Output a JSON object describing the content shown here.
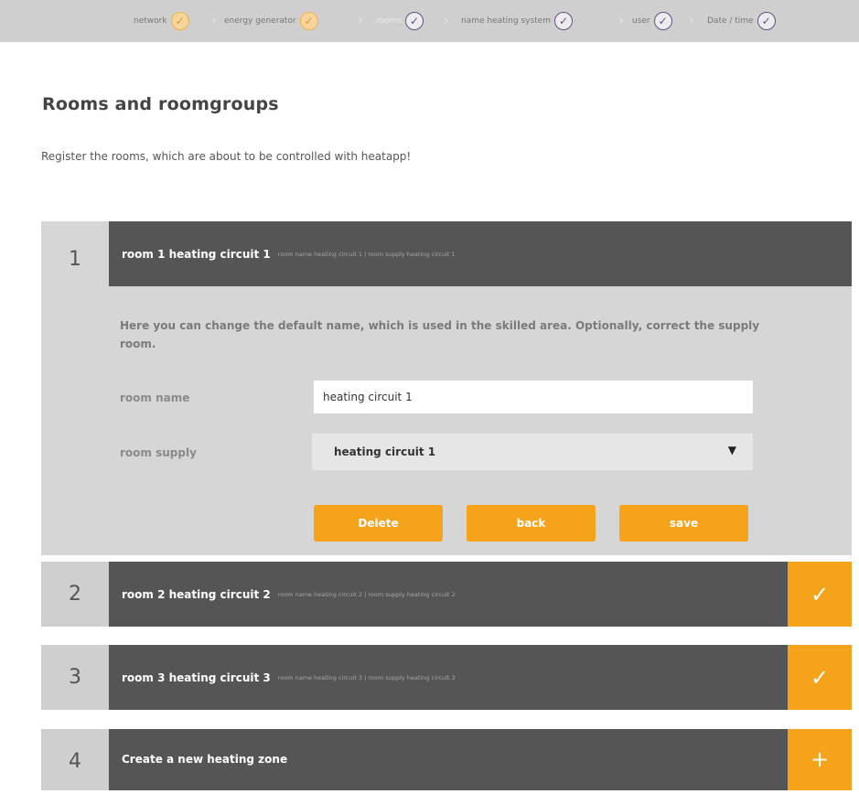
{
  "steps": [
    {
      "label": "network",
      "state": "done-orange"
    },
    {
      "label": "energy generator",
      "state": "done-orange"
    },
    {
      "label": "rooms",
      "state": "current"
    },
    {
      "label": "name heating system",
      "state": "done-purple"
    },
    {
      "label": "user",
      "state": "done-purple"
    },
    {
      "label": "Date / time",
      "state": "done-purple"
    }
  ],
  "step_icon": "✓",
  "step_separator": "›",
  "page": {
    "title": "Rooms and roomgroups",
    "intro": "Register the rooms, which are about to be controlled with heatapp!"
  },
  "rooms": [
    {
      "number": "1",
      "title": "room 1 heating circuit 1",
      "subtitle": "room name heating circuit 1 | room supply heating circuit 1",
      "help": "Here you can change the default name, which is used in the skilled area. Optionally, correct the supply room.",
      "room_name_label": "room name",
      "room_name_value": "heating circuit 1",
      "room_supply_label": "room supply",
      "room_supply_value": "heating circuit 1",
      "room_supply_arrow": "▼",
      "buttons": {
        "delete": "Delete",
        "back": "back",
        "save": "save"
      }
    },
    {
      "number": "2",
      "title": "room 2 heating circuit 2",
      "subtitle": "room name heating circuit 2 | room supply heating circuit 2",
      "action_icon": "✓"
    },
    {
      "number": "3",
      "title": "room 3 heating circuit 3",
      "subtitle": "room name heating circuit 3 | room supply heating circuit 3",
      "action_icon": "✓"
    },
    {
      "number": "4",
      "title": "Create a new heating zone",
      "action_icon": "+"
    }
  ],
  "colors": {
    "accent": "#f5a31a",
    "header_dark": "#555555",
    "panel_grey": "#d6d6d6",
    "step_done_purple": "#6a4c85"
  }
}
